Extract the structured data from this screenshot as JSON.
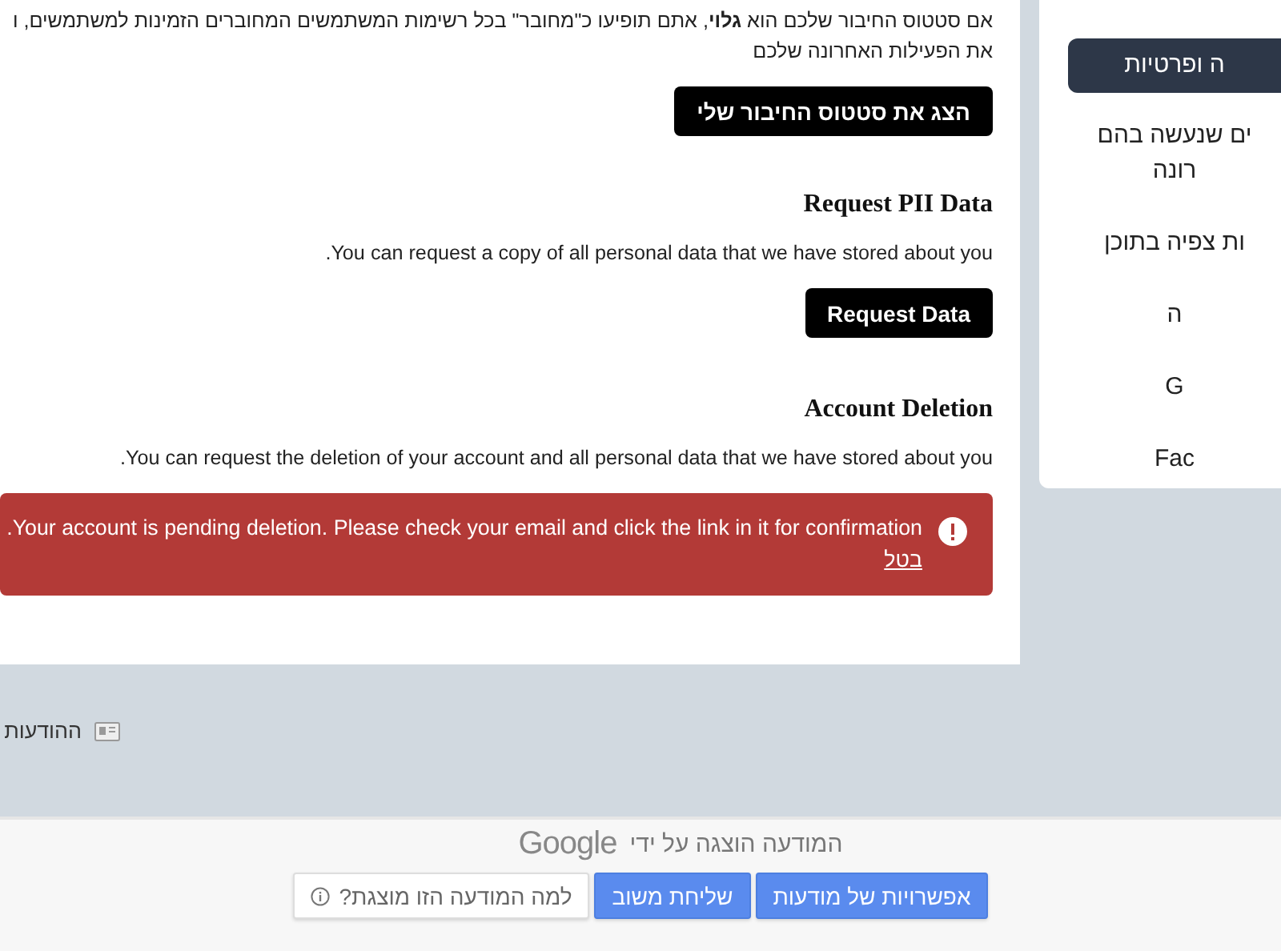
{
  "status_section": {
    "text": "אם סטטוס החיבור שלכם הוא **גלוי**, אתם תופיעו כ\"מחובר\" בכל רשימות המשתמשים המחוברים הזמינות למשתמשים, ו",
    "text_line_2": "את הפעילות האחרונה שלכם",
    "button": "הצג את סטטוס החיבור שלי"
  },
  "pii_section": {
    "heading": "Request PII Data",
    "text": "You can request a copy of all personal data that we have stored about you.",
    "button": "Request Data"
  },
  "deletion_section": {
    "heading": "Account Deletion",
    "text": "You can request the deletion of your account and all personal data that we have stored about you.",
    "alert": {
      "message": "Your account is pending deletion. Please check your email and click the link in it for confirmation.",
      "link": "בטל"
    }
  },
  "notifications_link": "ההודעות",
  "sidebar": {
    "items": [
      {
        "label": "ה ופרטיות",
        "selected": true
      },
      {
        "label": "ים שנעשה בהם רונה",
        "selected": false
      },
      {
        "label": "ות צפיה בתוכן",
        "selected": false
      },
      {
        "label": "ה",
        "selected": false
      },
      {
        "label": "G",
        "selected": false
      },
      {
        "label": "Fac",
        "selected": false
      }
    ]
  },
  "ad_footer": {
    "attribution": "המודעה הוצגה על ידי",
    "brand": "Google",
    "buttons": [
      {
        "label": "אפשרויות של מודעות",
        "kind": "primary"
      },
      {
        "label": "שליחת משוב",
        "kind": "primary"
      },
      {
        "label": "למה המודעה הזו מוצגת?",
        "kind": "info"
      }
    ]
  }
}
